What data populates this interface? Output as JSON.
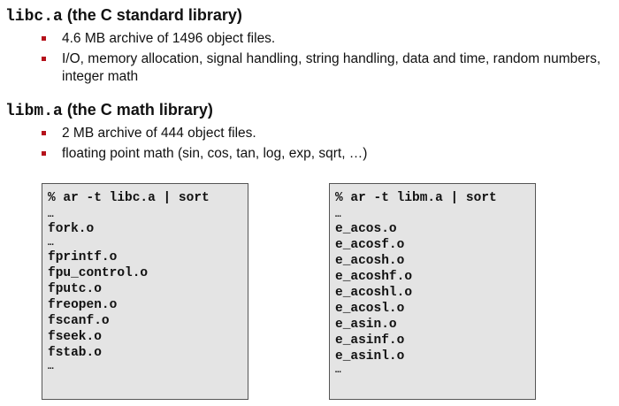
{
  "sections": [
    {
      "lib_name": "libc.a",
      "lib_desc": " (the C standard library)",
      "bullets": [
        "4.6 MB archive of 1496 object files.",
        "I/O, memory allocation, signal handling, string handling, data and time, random numbers, integer math"
      ]
    },
    {
      "lib_name": "libm.a",
      "lib_desc": " (the C math library)",
      "bullets": [
        "2 MB archive of 444 object files.",
        "floating point math (sin, cos, tan, log, exp, sqrt, …)"
      ]
    }
  ],
  "code_boxes": [
    {
      "command": "% ar -t libc.a | sort",
      "ellipsis": "…",
      "first": "fork.o",
      "files": [
        "fprintf.o",
        "fpu_control.o",
        "fputc.o",
        "freopen.o",
        "fscanf.o",
        "fseek.o",
        "fstab.o"
      ]
    },
    {
      "command": "% ar -t libm.a | sort",
      "ellipsis": "…",
      "files": [
        "e_acos.o",
        "e_acosf.o",
        "e_acosh.o",
        "e_acoshf.o",
        "e_acoshl.o",
        "e_acosl.o",
        "e_asin.o",
        "e_asinf.o",
        "e_asinl.o"
      ]
    }
  ]
}
